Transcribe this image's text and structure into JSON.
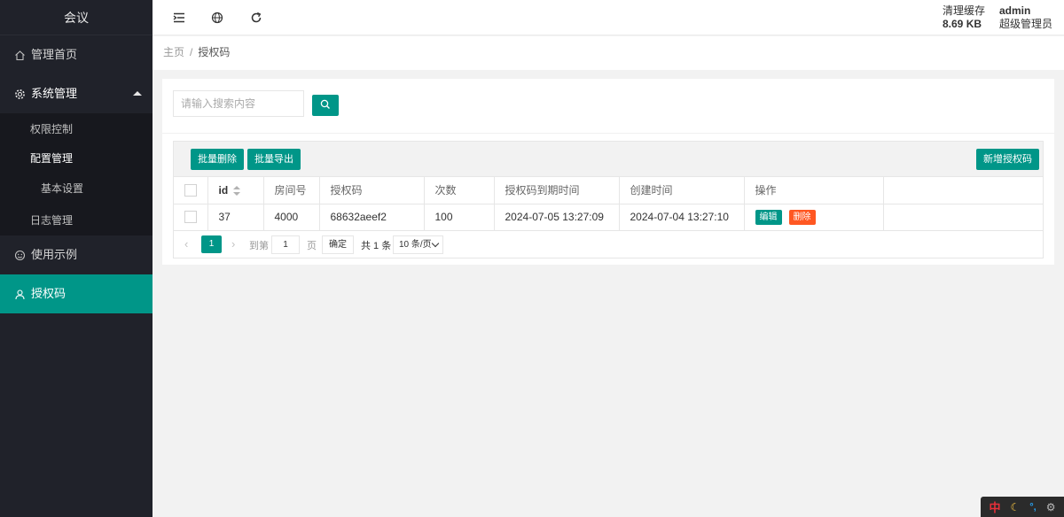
{
  "sidebar": {
    "logo": "会议",
    "items": [
      {
        "label": "管理首页",
        "icon": "home-icon"
      },
      {
        "label": "系统管理",
        "icon": "settings-icon",
        "expanded": true,
        "children": [
          {
            "label": "权限控制",
            "expanded": false
          },
          {
            "label": "配置管理",
            "expanded": true,
            "children": [
              {
                "label": "基本设置"
              }
            ]
          },
          {
            "label": "日志管理"
          }
        ]
      },
      {
        "label": "使用示例",
        "icon": "face-icon"
      },
      {
        "label": "授权码",
        "icon": "user-icon",
        "active": true
      }
    ]
  },
  "header": {
    "icons": [
      "collapse-menu-icon",
      "globe-icon",
      "refresh-icon"
    ],
    "cache_label": "清理缓存",
    "cache_size": "8.69 KB",
    "user_name": "admin",
    "user_role": "超级管理员"
  },
  "breadcrumb": {
    "home": "主页",
    "separator": "/",
    "current": "授权码"
  },
  "search": {
    "placeholder": "请输入搜索内容"
  },
  "toolbar": {
    "batch_delete": "批量删除",
    "batch_export": "批量导出",
    "add_code": "新增授权码"
  },
  "table": {
    "columns": [
      "id",
      "房间号",
      "授权码",
      "次数",
      "授权码到期时间",
      "创建时间",
      "操作"
    ],
    "rows": [
      {
        "id": "37",
        "room": "4000",
        "code": "68632aeef2",
        "count": "100",
        "expire": "2024-07-05 13:27:09",
        "created": "2024-07-04 13:27:10"
      }
    ],
    "edit_label": "编辑",
    "delete_label": "删除"
  },
  "pager": {
    "current_page": "1",
    "goto_label": "到第",
    "page_input": "1",
    "page_unit": "页",
    "confirm": "确定",
    "total": "共 1 条",
    "page_size": "10 条/页"
  },
  "ime": {
    "lang": "中",
    "colors": {
      "lang": "#e8303a",
      "moon": "#f6c342",
      "punc": "#29a4f5"
    }
  },
  "colors": {
    "primary": "#009688",
    "danger": "#ff5722",
    "sidebar_bg": "#20222a"
  }
}
